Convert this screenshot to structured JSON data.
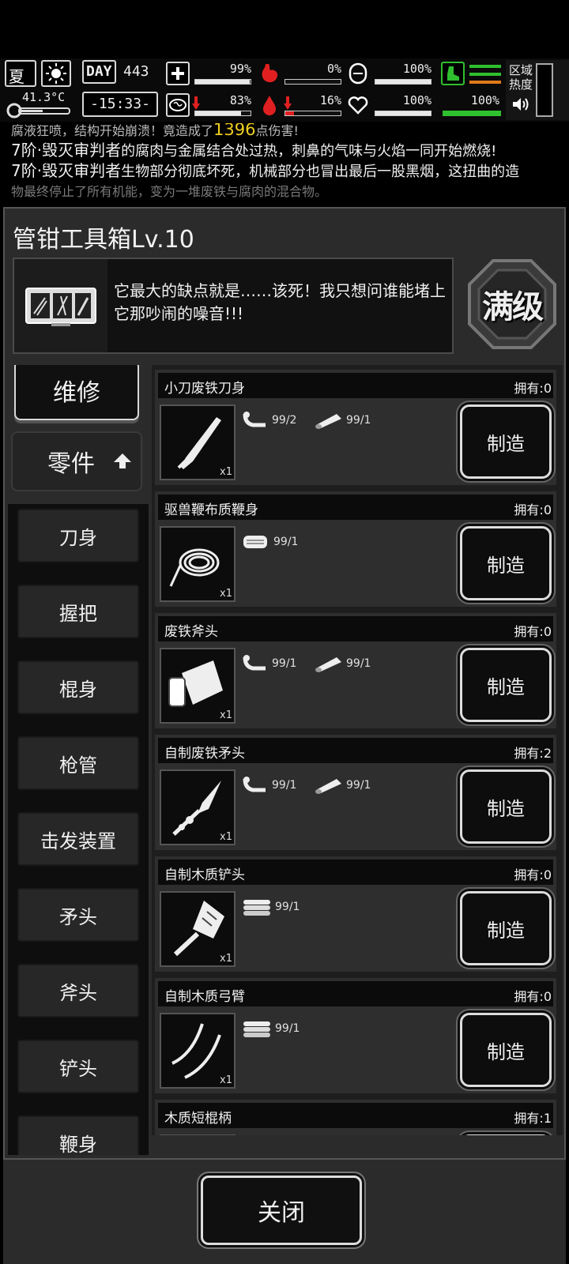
{
  "hud": {
    "season": "夏",
    "temperature": "41.3°C",
    "day_label": "DAY",
    "day_number": "443",
    "clock": "-15:33-",
    "health_pct": "99%",
    "hunger_pct": "0%",
    "armor_pct": "100%",
    "sanity_pct": "83%",
    "bleed_pct": "16%",
    "heart_pct": "100%",
    "stamina_pct": "100%",
    "region_heat_label": "区域\n热度",
    "bars": {
      "health": 0.99,
      "hunger": 0.0,
      "armor": 1.0,
      "sanity": 0.83,
      "bleed": 0.16,
      "heart": 1.0,
      "stamina": 1.0
    },
    "colors": {
      "stamina": "#2fc02f",
      "danger": "#e02020",
      "heat": "#e07a1a"
    }
  },
  "log": {
    "line1_a": "腐液狂喷，结构开始崩溃！竟造成了",
    "line1_dmg": "1396",
    "line1_b": "点伤害!",
    "line2_actor": "7阶·毁灭审判者",
    "line2_text": "的腐肉与金属结合处过热，刺鼻的气味与火焰一同开始燃烧!",
    "line3_actor": "7阶·毁灭审判者",
    "line3_text": "生物部分彻底坏死，机械部分也冒出最后一股黑烟，这扭曲的造",
    "line4": "物最终停止了所有机能，变为一堆废铁与腐肉的混合物。"
  },
  "panel": {
    "title": "管钳工具箱Lv.10",
    "description": "它最大的缺点就是……该死！我只想问谁能堵上它那吵闹的噪音!!!",
    "max_label": "满级"
  },
  "sidebar": {
    "top_categories": [
      {
        "label": "维修"
      },
      {
        "label": "零件"
      }
    ],
    "sub_categories": [
      {
        "label": "刀身"
      },
      {
        "label": "握把"
      },
      {
        "label": "棍身"
      },
      {
        "label": "枪管"
      },
      {
        "label": "击发装置"
      },
      {
        "label": "矛头"
      },
      {
        "label": "斧头"
      },
      {
        "label": "铲头"
      },
      {
        "label": "鞭身"
      }
    ]
  },
  "recipes": [
    {
      "name": "小刀废铁刀身",
      "owned": "拥有:0",
      "qty": "x1",
      "icon": "knife-blade-icon",
      "materials": [
        {
          "icon": "scrap-pipe-icon",
          "count": "99/2"
        },
        {
          "icon": "wood-log-icon",
          "count": "99/1"
        }
      ],
      "button": "制造"
    },
    {
      "name": "驱兽鞭布质鞭身",
      "owned": "拥有:0",
      "qty": "x1",
      "icon": "whip-coil-icon",
      "materials": [
        {
          "icon": "cloth-icon",
          "count": "99/1"
        }
      ],
      "button": "制造"
    },
    {
      "name": "废铁斧头",
      "owned": "拥有:0",
      "qty": "x1",
      "icon": "axe-head-icon",
      "materials": [
        {
          "icon": "scrap-pipe-icon",
          "count": "99/1"
        },
        {
          "icon": "wood-log-icon",
          "count": "99/1"
        }
      ],
      "button": "制造"
    },
    {
      "name": "自制废铁矛头",
      "owned": "拥有:2",
      "qty": "x1",
      "icon": "spear-head-icon",
      "materials": [
        {
          "icon": "scrap-pipe-icon",
          "count": "99/1"
        },
        {
          "icon": "wood-log-icon",
          "count": "99/1"
        }
      ],
      "button": "制造"
    },
    {
      "name": "自制木质铲头",
      "owned": "拥有:0",
      "qty": "x1",
      "icon": "shovel-head-icon",
      "materials": [
        {
          "icon": "planks-icon",
          "count": "99/1"
        }
      ],
      "button": "制造"
    },
    {
      "name": "自制木质弓臂",
      "owned": "拥有:0",
      "qty": "x1",
      "icon": "bow-limb-icon",
      "materials": [
        {
          "icon": "planks-icon",
          "count": "99/1"
        }
      ],
      "button": "制造"
    },
    {
      "name": "木质短棍柄",
      "owned": "拥有:1",
      "qty": "",
      "icon": "",
      "materials": [],
      "button": ""
    }
  ],
  "footer": {
    "close_label": "关闭"
  }
}
